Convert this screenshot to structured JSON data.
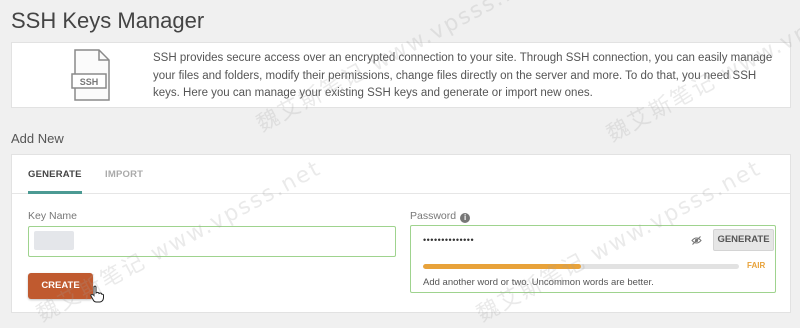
{
  "page": {
    "title": "SSH Keys Manager"
  },
  "intro": {
    "icon_label": "SSH",
    "text": "SSH provides secure access over an encrypted connection to your site. Through SSH connection, you can easily manage your files and folders, modify their permissions, change files directly on the server and more. To do that, you need SSH keys. Here you can manage your existing SSH keys and generate or import new ones."
  },
  "add_new": {
    "section_label": "Add New",
    "tabs": [
      {
        "label": "GENERATE",
        "active": true
      },
      {
        "label": "IMPORT",
        "active": false
      }
    ],
    "key_name": {
      "label": "Key Name",
      "value": ""
    },
    "password": {
      "label": "Password",
      "masked_value": "••••••••••••••",
      "generate_label": "GENERATE",
      "strength_label": "FAIR",
      "strength_fraction": 0.5,
      "hint": "Add another word or two. Uncommon words are better."
    },
    "create_label": "CREATE"
  },
  "watermark": {
    "text": "魏艾斯笔记 www.vpsss.net"
  },
  "colors": {
    "accent": "#4b9a93",
    "create_button": "#c05a2f",
    "strength_fair": "#e8a23a",
    "valid_border": "#9fd38e"
  }
}
